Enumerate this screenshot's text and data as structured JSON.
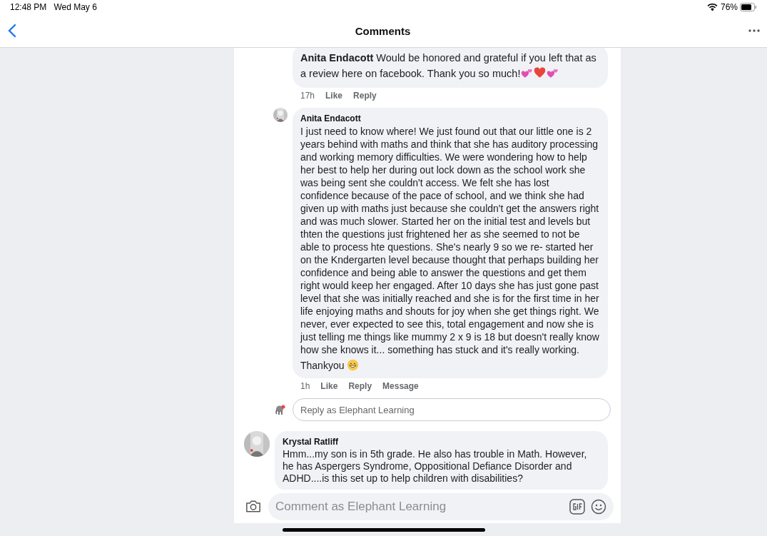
{
  "status_bar": {
    "time": "12:48 PM",
    "date": "Wed May 6",
    "battery": "76%"
  },
  "header": {
    "title": "Comments"
  },
  "comments": [
    {
      "kind": "inline",
      "nested": true,
      "author": "Anita Endacott",
      "paragraphs": [
        {
          "text": "Would be honored and grateful if you left that as a review here on facebook.  Thank you so much!",
          "emoji": [
            {
              "kind": "two-hearts"
            },
            {
              "kind": "heart"
            },
            {
              "kind": "two-hearts"
            }
          ]
        }
      ],
      "time": "17h",
      "actions": [
        "Like",
        "Reply"
      ]
    },
    {
      "kind": "stacked",
      "nested": true,
      "author": "Anita Endacott",
      "paragraphs": [
        {
          "text": "I just need to know where! We just found out that our little one is 2 years behind with maths and think that she has auditory processing and working memory difficulties. We were wondering how to help her best to help her during out lock down as the school work she was being sent she couldn't access. We felt she has lost confidence because of the pace of school, and we think she had given up with maths just because she couldn't get the answers right and was much slower.  Started her on the initial test and levels but thten the questions just frightened her as she seemed to not be able to process hte questions. She's nearly 9 so we re- started her on the Kndergarten level because thought that perhaps building her confidence and being able to answer the questions and get them right would keep her engaged. After 10 days she has just gone past level that she was initially reached and she is for the first time in her life enjoying maths and shouts for joy when she get things right. We never, ever expected to see this, total engagement and now she is just telling me things like mummy 2 x 9 is 18 but doesn't really know how she knows it... something has stuck and it's really working."
        },
        {
          "text": "Thankyou",
          "emoji": [
            {
              "kind": "grin"
            }
          ]
        }
      ],
      "time": "1h",
      "actions": [
        "Like",
        "Reply",
        "Message"
      ]
    },
    {
      "kind": "reply_field",
      "placeholder": "Reply as Elephant Learning"
    },
    {
      "kind": "stacked",
      "nested": false,
      "author": "Krystal Ratliff",
      "paragraphs": [
        {
          "text": "Hmm...my son is in 5th grade. He also has trouble in Math. However, he has Aspergers Syndrome, Oppositional Defiance Disorder and ADHD....is this set up to help children with disabilities?"
        }
      ]
    }
  ],
  "composer": {
    "placeholder": "Comment as Elephant Learning"
  }
}
